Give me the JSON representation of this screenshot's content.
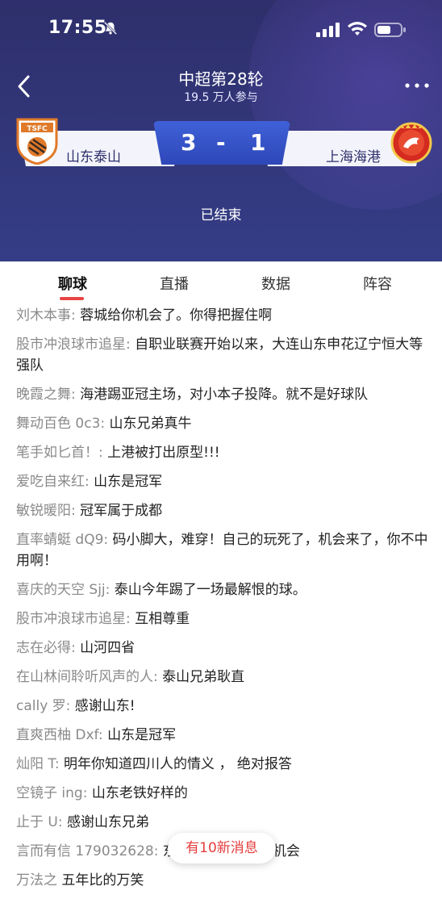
{
  "status_bar": {
    "time": "17:55"
  },
  "header": {
    "title": "中超第28轮",
    "subtitle": "19.5 万人参与",
    "home_team": "山东泰山",
    "away_team": "上海海港",
    "home_score": "3",
    "separator": "-",
    "away_score": "1",
    "status": "已结束",
    "home_logo_text": "TSFC"
  },
  "tabs": [
    {
      "label": "聊球"
    },
    {
      "label": "直播"
    },
    {
      "label": "数据"
    },
    {
      "label": "阵容"
    }
  ],
  "chat": [
    {
      "user": "刘木本事:",
      "text": " 蓉城给你机会了。你得把握住啊"
    },
    {
      "user": "股市冲浪球市追星:",
      "text": " 自职业联赛开始以来，大连山东申花辽宁恒大等强队"
    },
    {
      "user": "晚霞之舞:",
      "text": " 海港踢亚冠主场，对小本子投降。就不是好球队"
    },
    {
      "user": "舞动百色 0c3:",
      "text": " 山东兄弟真牛"
    },
    {
      "user": "笔手如匕首！:",
      "text": " 上港被打出原型!!!"
    },
    {
      "user": "爱吃自来红:",
      "text": " 山东是冠军"
    },
    {
      "user": "敏锐暖阳:",
      "text": " 冠军属于成都"
    },
    {
      "user": "直率蜻蜓 dQ9:",
      "text": " 码小脚大，难穿！自己的玩死了，机会来了，你不中用啊！"
    },
    {
      "user": "喜庆的天空 Sjj:",
      "text": " 泰山今年踢了一场最解恨的球。"
    },
    {
      "user": "股市冲浪球市追星:",
      "text": " 互相尊重"
    },
    {
      "user": "志在必得:",
      "text": " 山河四省"
    },
    {
      "user": "在山林间聆听风声的人:",
      "text": " 泰山兄弟耿直"
    },
    {
      "user": "cally 罗:",
      "text": " 感谢山东!"
    },
    {
      "user": "直爽西柚 Dxf:",
      "text": " 山东是冠军"
    },
    {
      "user": "灿阳 T:",
      "text": " 明年你知道四川人的情义 ， 绝对报答"
    },
    {
      "user": "空镜子 ing:",
      "text": " 山东老铁好样的"
    },
    {
      "user": "止于 U:",
      "text": " 感谢山东兄弟"
    },
    {
      "user": "言而有信 179032628:",
      "text": " 东新人，给新人个机会"
    },
    {
      "user": "万法之",
      "text": " 五年比的万笑"
    }
  ],
  "new_message_pill": "有10新消息",
  "colors": {
    "header_bg": "#32377a",
    "score_box": "#3a57cc",
    "accent": "#e74545"
  }
}
